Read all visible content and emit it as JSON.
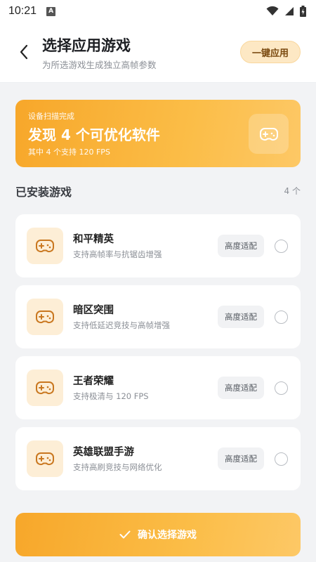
{
  "status_bar": {
    "time": "10:21",
    "notification_letter": "A"
  },
  "header": {
    "title": "选择应用游戏",
    "subtitle": "为所选游戏生成独立高帧参数",
    "apply_button": "一键应用"
  },
  "banner": {
    "label": "设备扫描完成",
    "title": "发现 4 个可优化软件",
    "subtitle": "其中 4 个支持 120 FPS"
  },
  "section": {
    "title": "已安装游戏",
    "count": "4 个"
  },
  "games": [
    {
      "name": "和平精英",
      "desc": "支持高帧率与抗锯齿增强",
      "tag": "高度适配",
      "selected": false
    },
    {
      "name": "暗区突围",
      "desc": "支持低延迟竞技与高帧增强",
      "tag": "高度适配",
      "selected": false
    },
    {
      "name": "王者荣耀",
      "desc": "支持极清与 120 FPS",
      "tag": "高度适配",
      "selected": false
    },
    {
      "name": "英雄联盟手游",
      "desc": "支持高刷竞技与网络优化",
      "tag": "高度适配",
      "selected": false
    }
  ],
  "confirm_button": "确认选择游戏",
  "colors": {
    "accent": "#f7a72a",
    "accent_light": "#fdeed6",
    "game_icon": "#c9771f",
    "background": "#f2f3f5"
  },
  "icons": {
    "back": "chevron-left-icon",
    "gamepad": "gamepad-icon",
    "check": "check-icon",
    "wifi": "wifi-icon",
    "signal": "signal-icon",
    "battery": "battery-icon"
  }
}
